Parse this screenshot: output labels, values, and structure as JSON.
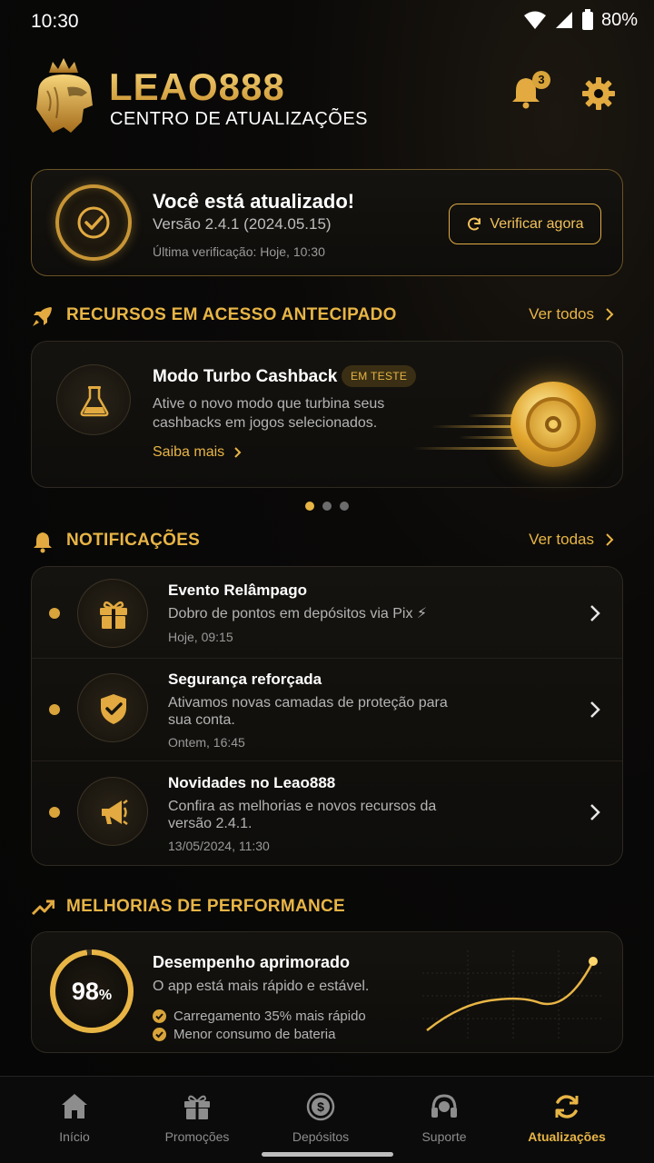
{
  "status": {
    "time": "10:30",
    "battery": "80%"
  },
  "header": {
    "brand": "LEAO888",
    "subtitle": "CENTRO DE ATUALIZAÇÕES",
    "notification_count": "3",
    "icons": [
      "lion-logo",
      "bell-icon",
      "gear-icon"
    ]
  },
  "update_card": {
    "title": "Você está atualizado!",
    "version": "Versão 2.4.1 (2024.05.15)",
    "last_check": "Última verificação: Hoje, 10:30",
    "button": "Verificar agora"
  },
  "early_access": {
    "section_title": "RECURSOS EM ACESSO ANTECIPADO",
    "see_all": "Ver todos",
    "feature": {
      "title": "Modo Turbo Cashback",
      "badge": "EM TESTE",
      "description": "Ative o novo modo que turbina seus cashbacks em jogos selecionados.",
      "link": "Saiba mais"
    },
    "carousel_pages": 3,
    "carousel_active": 1
  },
  "notifications": {
    "section_title": "NOTIFICAÇÕES",
    "see_all": "Ver todas",
    "items": [
      {
        "title": "Evento Relâmpago",
        "body": "Dobro de pontos em depósitos via Pix ⚡",
        "time": "Hoje, 09:15",
        "icon": "gift-icon"
      },
      {
        "title": "Segurança reforçada",
        "body": "Ativamos novas camadas de proteção para sua conta.",
        "time": "Ontem, 16:45",
        "icon": "shield-check-icon"
      },
      {
        "title": "Novidades no Leao888",
        "body": "Confira as melhorias e novos recursos da versão 2.4.1.",
        "time": "13/05/2024, 11:30",
        "icon": "megaphone-icon"
      }
    ]
  },
  "performance": {
    "section_title": "MELHORIAS DE PERFORMANCE",
    "score": "98",
    "score_unit": "%",
    "score_value": 98,
    "title": "Desempenho aprimorado",
    "description": "O app está mais rápido e estável.",
    "bullets": [
      "Carregamento 35% mais rápido",
      "Menor consumo de bateria"
    ]
  },
  "nav": {
    "items": [
      {
        "label": "Início",
        "icon": "home-icon"
      },
      {
        "label": "Promoções",
        "icon": "gift-icon"
      },
      {
        "label": "Depósitos",
        "icon": "dollar-coin-icon"
      },
      {
        "label": "Suporte",
        "icon": "headset-icon"
      },
      {
        "label": "Atualizações",
        "icon": "refresh-icon"
      }
    ],
    "active": "Atualizações"
  },
  "colors": {
    "accent": "#e8b545",
    "background": "#060606",
    "card": "#121110"
  }
}
